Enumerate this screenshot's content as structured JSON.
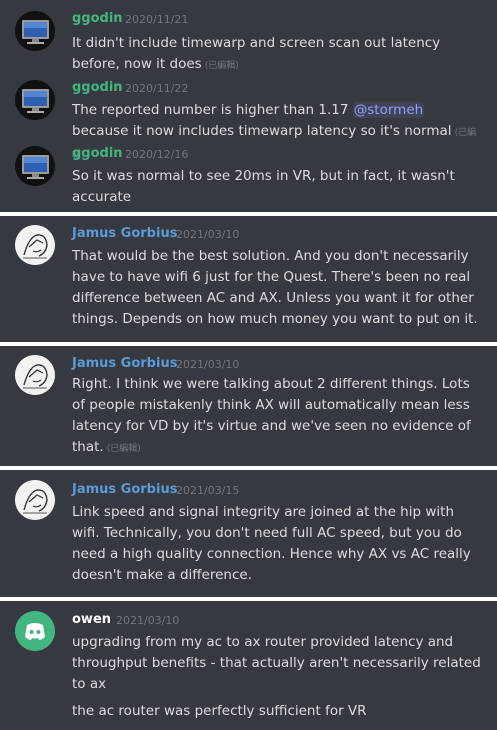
{
  "colors": {
    "panel_bg": "#36393f",
    "ggodin_name": "#43b581",
    "jamus_name": "#5b9cd8",
    "owen_name": "#ffffff",
    "timestamp": "#72767d",
    "mention": "#8fa1ff",
    "discord_blurple": "#43b581"
  },
  "messages": [
    {
      "author": "ggodin",
      "time": "2020/11/21",
      "text": "It didn't include timewarp and screen scan out latency before, now it does",
      "edited": "(已編輯)",
      "avatar": "monitor-icon"
    },
    {
      "author": "ggodin",
      "time": "2020/11/22",
      "text_before": "The reported number is higher than 1.17 ",
      "mention": "@stormeh",
      "text_after": " because it now includes timewarp latency so it's normal",
      "edited": "(已編輯)",
      "avatar": "monitor-icon"
    },
    {
      "author": "ggodin",
      "time": "2020/12/16",
      "text": "So it was normal to see 20ms in VR, but in fact, it wasn't accurate",
      "avatar": "monitor-icon"
    },
    {
      "author": "Jamus Gorbius",
      "time": "2021/03/10",
      "text": "That would be the best solution. And you don't necessarily have to have wifi 6 just for the Quest. There's been no real difference between AC and AX. Unless you want it for other things. Depends on how much money you want to put on it.",
      "avatar": "sketch-face-icon"
    },
    {
      "author": "Jamus Gorbius",
      "time": "2021/03/10",
      "text": "Right. I think we were talking about 2 different things. Lots of people mistakenly think AX will automatically mean less latency for VD by it's virtue and we've seen no evidence of that.",
      "edited": "(已編輯)",
      "avatar": "sketch-face-icon"
    },
    {
      "author": "Jamus Gorbius",
      "time": "2021/03/15",
      "text": "Link speed and signal integrity are joined at the hip with wifi. Technically, you don't need full AC speed, but you do need a high quality connection. Hence why AX vs AC really doesn't make a difference.",
      "avatar": "sketch-face-icon"
    },
    {
      "author": "owen",
      "time": "2021/03/10",
      "text": "upgrading from my ac to ax router provided latency and throughput benefits - that actually aren't necessarily related to ax",
      "text2": "the ac router was perfectly sufficient for VR",
      "avatar": "discord-logo-icon"
    }
  ]
}
